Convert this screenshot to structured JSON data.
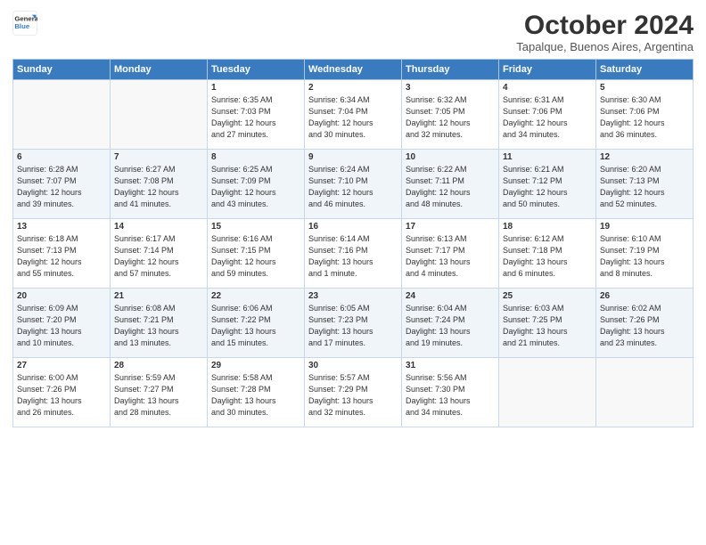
{
  "logo": {
    "line1": "General",
    "line2": "Blue"
  },
  "title": "October 2024",
  "subtitle": "Tapalque, Buenos Aires, Argentina",
  "days_of_week": [
    "Sunday",
    "Monday",
    "Tuesday",
    "Wednesday",
    "Thursday",
    "Friday",
    "Saturday"
  ],
  "weeks": [
    [
      {
        "day": "",
        "info": ""
      },
      {
        "day": "",
        "info": ""
      },
      {
        "day": "1",
        "info": "Sunrise: 6:35 AM\nSunset: 7:03 PM\nDaylight: 12 hours\nand 27 minutes."
      },
      {
        "day": "2",
        "info": "Sunrise: 6:34 AM\nSunset: 7:04 PM\nDaylight: 12 hours\nand 30 minutes."
      },
      {
        "day": "3",
        "info": "Sunrise: 6:32 AM\nSunset: 7:05 PM\nDaylight: 12 hours\nand 32 minutes."
      },
      {
        "day": "4",
        "info": "Sunrise: 6:31 AM\nSunset: 7:06 PM\nDaylight: 12 hours\nand 34 minutes."
      },
      {
        "day": "5",
        "info": "Sunrise: 6:30 AM\nSunset: 7:06 PM\nDaylight: 12 hours\nand 36 minutes."
      }
    ],
    [
      {
        "day": "6",
        "info": "Sunrise: 6:28 AM\nSunset: 7:07 PM\nDaylight: 12 hours\nand 39 minutes."
      },
      {
        "day": "7",
        "info": "Sunrise: 6:27 AM\nSunset: 7:08 PM\nDaylight: 12 hours\nand 41 minutes."
      },
      {
        "day": "8",
        "info": "Sunrise: 6:25 AM\nSunset: 7:09 PM\nDaylight: 12 hours\nand 43 minutes."
      },
      {
        "day": "9",
        "info": "Sunrise: 6:24 AM\nSunset: 7:10 PM\nDaylight: 12 hours\nand 46 minutes."
      },
      {
        "day": "10",
        "info": "Sunrise: 6:22 AM\nSunset: 7:11 PM\nDaylight: 12 hours\nand 48 minutes."
      },
      {
        "day": "11",
        "info": "Sunrise: 6:21 AM\nSunset: 7:12 PM\nDaylight: 12 hours\nand 50 minutes."
      },
      {
        "day": "12",
        "info": "Sunrise: 6:20 AM\nSunset: 7:13 PM\nDaylight: 12 hours\nand 52 minutes."
      }
    ],
    [
      {
        "day": "13",
        "info": "Sunrise: 6:18 AM\nSunset: 7:13 PM\nDaylight: 12 hours\nand 55 minutes."
      },
      {
        "day": "14",
        "info": "Sunrise: 6:17 AM\nSunset: 7:14 PM\nDaylight: 12 hours\nand 57 minutes."
      },
      {
        "day": "15",
        "info": "Sunrise: 6:16 AM\nSunset: 7:15 PM\nDaylight: 12 hours\nand 59 minutes."
      },
      {
        "day": "16",
        "info": "Sunrise: 6:14 AM\nSunset: 7:16 PM\nDaylight: 13 hours\nand 1 minute."
      },
      {
        "day": "17",
        "info": "Sunrise: 6:13 AM\nSunset: 7:17 PM\nDaylight: 13 hours\nand 4 minutes."
      },
      {
        "day": "18",
        "info": "Sunrise: 6:12 AM\nSunset: 7:18 PM\nDaylight: 13 hours\nand 6 minutes."
      },
      {
        "day": "19",
        "info": "Sunrise: 6:10 AM\nSunset: 7:19 PM\nDaylight: 13 hours\nand 8 minutes."
      }
    ],
    [
      {
        "day": "20",
        "info": "Sunrise: 6:09 AM\nSunset: 7:20 PM\nDaylight: 13 hours\nand 10 minutes."
      },
      {
        "day": "21",
        "info": "Sunrise: 6:08 AM\nSunset: 7:21 PM\nDaylight: 13 hours\nand 13 minutes."
      },
      {
        "day": "22",
        "info": "Sunrise: 6:06 AM\nSunset: 7:22 PM\nDaylight: 13 hours\nand 15 minutes."
      },
      {
        "day": "23",
        "info": "Sunrise: 6:05 AM\nSunset: 7:23 PM\nDaylight: 13 hours\nand 17 minutes."
      },
      {
        "day": "24",
        "info": "Sunrise: 6:04 AM\nSunset: 7:24 PM\nDaylight: 13 hours\nand 19 minutes."
      },
      {
        "day": "25",
        "info": "Sunrise: 6:03 AM\nSunset: 7:25 PM\nDaylight: 13 hours\nand 21 minutes."
      },
      {
        "day": "26",
        "info": "Sunrise: 6:02 AM\nSunset: 7:26 PM\nDaylight: 13 hours\nand 23 minutes."
      }
    ],
    [
      {
        "day": "27",
        "info": "Sunrise: 6:00 AM\nSunset: 7:26 PM\nDaylight: 13 hours\nand 26 minutes."
      },
      {
        "day": "28",
        "info": "Sunrise: 5:59 AM\nSunset: 7:27 PM\nDaylight: 13 hours\nand 28 minutes."
      },
      {
        "day": "29",
        "info": "Sunrise: 5:58 AM\nSunset: 7:28 PM\nDaylight: 13 hours\nand 30 minutes."
      },
      {
        "day": "30",
        "info": "Sunrise: 5:57 AM\nSunset: 7:29 PM\nDaylight: 13 hours\nand 32 minutes."
      },
      {
        "day": "31",
        "info": "Sunrise: 5:56 AM\nSunset: 7:30 PM\nDaylight: 13 hours\nand 34 minutes."
      },
      {
        "day": "",
        "info": ""
      },
      {
        "day": "",
        "info": ""
      }
    ]
  ]
}
